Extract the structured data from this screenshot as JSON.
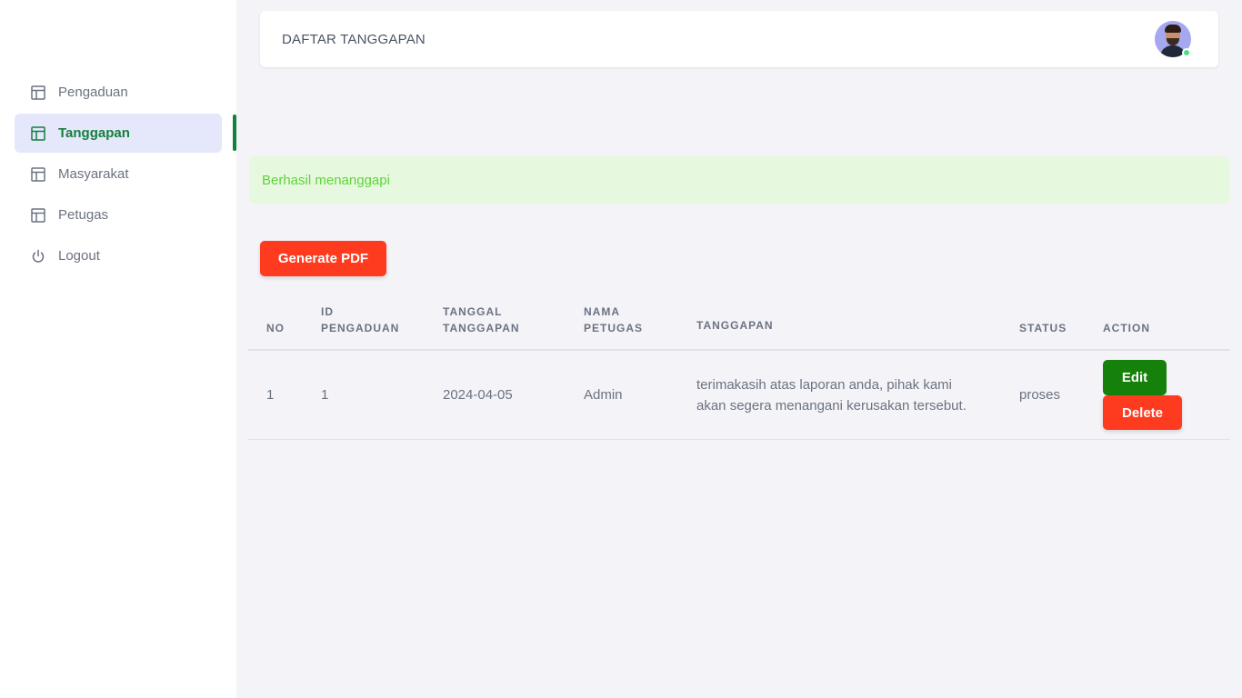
{
  "header": {
    "title": "DAFTAR TANGGAPAN"
  },
  "sidebar": {
    "items": [
      {
        "label": "Pengaduan",
        "icon": "layout-icon",
        "active": false
      },
      {
        "label": "Tanggapan",
        "icon": "layout-icon",
        "active": true
      },
      {
        "label": "Masyarakat",
        "icon": "layout-icon",
        "active": false
      },
      {
        "label": "Petugas",
        "icon": "layout-icon",
        "active": false
      },
      {
        "label": "Logout",
        "icon": "power-icon",
        "active": false
      }
    ]
  },
  "alert": {
    "message": "Berhasil menanggapi"
  },
  "toolbar": {
    "generate_pdf_label": "Generate PDF"
  },
  "table": {
    "headers": {
      "no": "NO",
      "id_line1": "ID",
      "id_line2": "PENGADUAN",
      "tgl_line1": "TANGGAL",
      "tgl_line2": "TANGGAPAN",
      "nama_line1": "NAMA",
      "nama_line2": "PETUGAS",
      "tanggapan": "TANGGAPAN",
      "status": "STATUS",
      "action": "ACTION"
    },
    "rows": [
      {
        "no": "1",
        "id_pengaduan": "1",
        "tanggal": "2024-04-05",
        "petugas": "Admin",
        "tanggapan_line1": "terimakasih atas laporan anda, pihak kami",
        "tanggapan_line2": "akan segera menangani kerusakan tersebut.",
        "status": "proses",
        "edit_label": "Edit",
        "delete_label": "Delete"
      }
    ]
  },
  "colors": {
    "accent_green": "#15800a",
    "danger": "#ff3b1f",
    "active_bg": "#e5e7fb",
    "alert_bg": "#e6f9df",
    "alert_text": "#5fd43a",
    "online": "#4ade80"
  }
}
